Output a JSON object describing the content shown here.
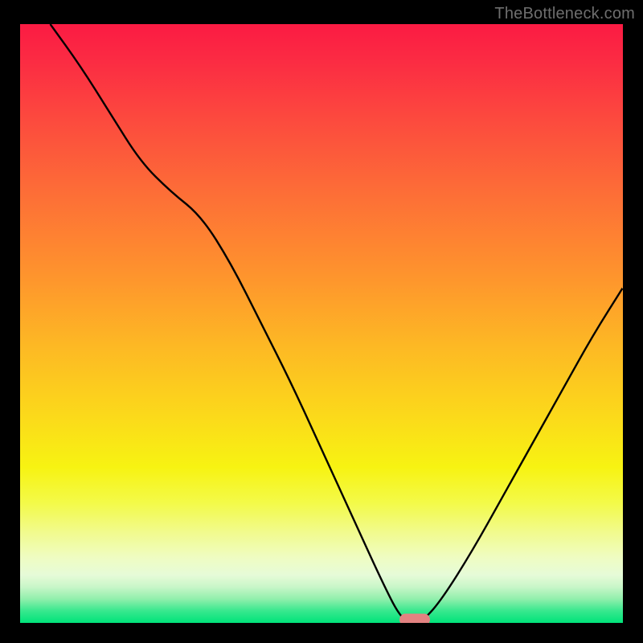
{
  "watermark": "TheBottleneck.com",
  "chart_data": {
    "type": "line",
    "title": "",
    "xlabel": "",
    "ylabel": "",
    "axis_min_percent": 0,
    "axis_max_percent": 100,
    "ylim": [
      0,
      100
    ],
    "xlim": [
      0,
      100
    ],
    "series": [
      {
        "name": "bottleneck-curve",
        "x": [
          5,
          10,
          15,
          20,
          25,
          30,
          35,
          40,
          45,
          50,
          55,
          60,
          63,
          65,
          67,
          70,
          75,
          80,
          85,
          90,
          95,
          100
        ],
        "values": [
          100,
          93,
          85,
          77,
          72,
          68,
          60,
          50,
          40,
          29,
          18,
          7,
          1,
          0,
          0.5,
          4,
          12,
          21,
          30,
          39,
          48,
          56
        ]
      }
    ],
    "optimal_marker": {
      "x_percent": 65.5,
      "y_percent": 0.5
    },
    "background_gradient": {
      "top": "#fb1b43",
      "mid": "#fcd81e",
      "bottom": "#00e37a"
    },
    "frame_color": "#000000"
  }
}
